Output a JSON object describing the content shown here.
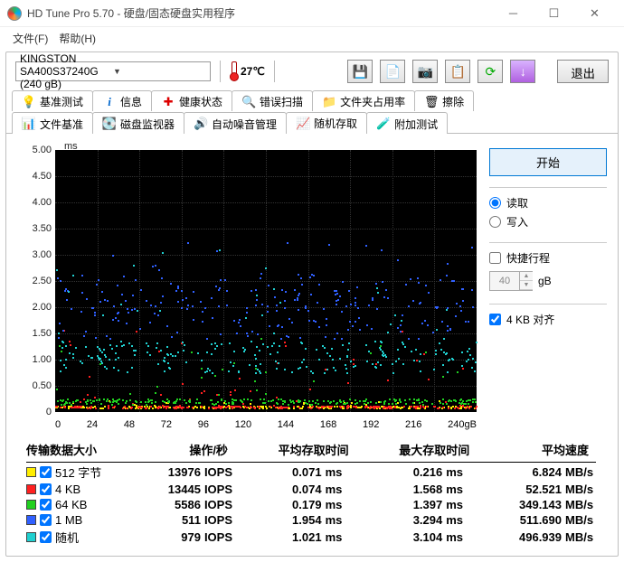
{
  "window": {
    "title": "HD Tune Pro 5.70 - 硬盘/固态硬盘实用程序"
  },
  "menu": {
    "file": "文件(F)",
    "help": "帮助(H)"
  },
  "toprow": {
    "drive": "KINGSTON SA400S37240G (240 gB)",
    "temp": "27℃",
    "exit": "退出"
  },
  "toolbar_icons": [
    "save-icon",
    "copy-text-icon",
    "screenshot-icon",
    "copy-icon",
    "refresh-icon",
    "down-arrow-icon"
  ],
  "tabs_row1": [
    {
      "label": "基准测试",
      "icon": "bulb"
    },
    {
      "label": "信息",
      "icon": "info"
    },
    {
      "label": "健康状态",
      "icon": "health"
    },
    {
      "label": "错误扫描",
      "icon": "scan"
    },
    {
      "label": "文件夹占用率",
      "icon": "folder"
    },
    {
      "label": "擦除",
      "icon": "erase"
    }
  ],
  "tabs_row2": [
    {
      "label": "文件基准",
      "icon": "filebench"
    },
    {
      "label": "磁盘监视器",
      "icon": "monitor"
    },
    {
      "label": "自动噪音管理",
      "icon": "aam"
    },
    {
      "label": "随机存取",
      "icon": "random",
      "active": true
    },
    {
      "label": "附加测试",
      "icon": "extra"
    }
  ],
  "side": {
    "start": "开始",
    "read": "读取",
    "write": "写入",
    "quick": "快捷行程",
    "spin": "40",
    "spin_unit": "gB",
    "align": "4 KB 对齐"
  },
  "chart_data": {
    "type": "scatter",
    "unit": "ms",
    "ylim": [
      0,
      5.0
    ],
    "yticks": [
      "5.00",
      "4.50",
      "4.00",
      "3.50",
      "3.00",
      "2.50",
      "2.00",
      "1.50",
      "1.00",
      "0.50",
      "0"
    ],
    "xlim": [
      0,
      240
    ],
    "xticks": [
      "0",
      "24",
      "48",
      "72",
      "96",
      "120",
      "144",
      "168",
      "192",
      "216",
      "240gB"
    ],
    "series": [
      {
        "name": "512 字节",
        "color": "#ffee00",
        "avg_ms": 0.071,
        "max_ms": 0.216
      },
      {
        "name": "4 KB",
        "color": "#ff2020",
        "avg_ms": 0.074,
        "max_ms": 1.568
      },
      {
        "name": "64 KB",
        "color": "#20d020",
        "avg_ms": 0.179,
        "max_ms": 1.397
      },
      {
        "name": "1 MB",
        "color": "#3060ff",
        "avg_ms": 1.954,
        "max_ms": 3.294
      },
      {
        "name": "随机",
        "color": "#20d0d0",
        "avg_ms": 1.021,
        "max_ms": 3.104
      }
    ]
  },
  "table": {
    "headers": [
      "传输数据大小",
      "操作/秒",
      "平均存取时间",
      "最大存取时间",
      "平均速度"
    ],
    "rows": [
      {
        "color": "#ffee00",
        "checked": true,
        "label": "512 字节",
        "iops": "13976",
        "avg": "0.071",
        "max": "0.216",
        "rate": "6.824"
      },
      {
        "color": "#ff2020",
        "checked": true,
        "label": "4 KB",
        "iops": "13445",
        "avg": "0.074",
        "max": "1.568",
        "rate": "52.521"
      },
      {
        "color": "#20d020",
        "checked": true,
        "label": "64 KB",
        "iops": "5586",
        "avg": "0.179",
        "max": "1.397",
        "rate": "349.143"
      },
      {
        "color": "#3060ff",
        "checked": true,
        "label": "1 MB",
        "iops": "511",
        "avg": "1.954",
        "max": "3.294",
        "rate": "511.690"
      },
      {
        "color": "#20d0d0",
        "checked": true,
        "label": "随机",
        "iops": "979",
        "avg": "1.021",
        "max": "3.104",
        "rate": "496.939"
      }
    ],
    "units": {
      "iops": "IOPS",
      "ms": "ms",
      "rate": "MB/s"
    }
  }
}
